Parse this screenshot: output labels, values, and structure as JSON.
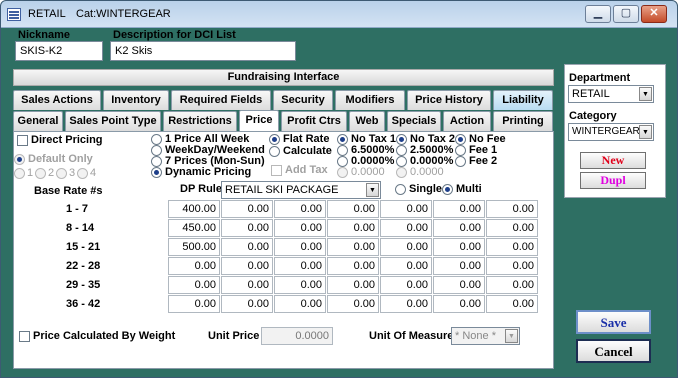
{
  "window": {
    "title": "RETAIL",
    "category_title": "Cat:WINTERGEAR"
  },
  "header": {
    "nickname_label": "Nickname",
    "nickname_value": "SKIS-K2",
    "description_label": "Description for DCI List",
    "description_value": "K2 Skis"
  },
  "fundraising_label": "Fundraising Interface",
  "tabs_row1": [
    "Sales Actions",
    "Inventory",
    "Required Fields",
    "Security",
    "Modifiers",
    "Price History",
    "Liability"
  ],
  "tabs_row2": [
    "General",
    "Sales Point Type",
    "Restrictions",
    "Price",
    "Profit Ctrs",
    "Web",
    "Specials",
    "Action",
    "Printing"
  ],
  "active_tab": "Price",
  "price": {
    "direct_pricing_label": "Direct Pricing",
    "default_only_label": "Default Only",
    "default_options": [
      "1",
      "2",
      "3",
      "4"
    ],
    "price_modes": [
      "1 Price All Week",
      "WeekDay/Weekend",
      "7 Prices (Mon-Sun)",
      "Dynamic Pricing"
    ],
    "price_mode_selected": "Dynamic Pricing",
    "rate_modes": [
      "Flat Rate",
      "Calculate"
    ],
    "rate_mode_selected": "Flat Rate",
    "add_tax_label": "Add Tax",
    "tax1": [
      "No Tax 1",
      "6.5000%",
      "0.0000%",
      "0.0000"
    ],
    "tax2": [
      "No Tax 2",
      "2.5000%",
      "0.0000%",
      "0.0000"
    ],
    "fee": [
      "No Fee",
      "Fee 1",
      "Fee 2"
    ],
    "base_rate_label": "Base Rate #s",
    "dp_rule_label": "DP Rule",
    "dp_rule_value": "RETAIL SKI PACKAGE",
    "single_label": "Single",
    "multi_label": "Multi",
    "multi_selected": true,
    "rows": [
      {
        "range": "1 - 7",
        "values": [
          "400.00",
          "0.00",
          "0.00",
          "0.00",
          "0.00",
          "0.00",
          "0.00"
        ]
      },
      {
        "range": "8 - 14",
        "values": [
          "450.00",
          "0.00",
          "0.00",
          "0.00",
          "0.00",
          "0.00",
          "0.00"
        ]
      },
      {
        "range": "15 - 21",
        "values": [
          "500.00",
          "0.00",
          "0.00",
          "0.00",
          "0.00",
          "0.00",
          "0.00"
        ]
      },
      {
        "range": "22 - 28",
        "values": [
          "0.00",
          "0.00",
          "0.00",
          "0.00",
          "0.00",
          "0.00",
          "0.00"
        ]
      },
      {
        "range": "29 - 35",
        "values": [
          "0.00",
          "0.00",
          "0.00",
          "0.00",
          "0.00",
          "0.00",
          "0.00"
        ]
      },
      {
        "range": "36 - 42",
        "values": [
          "0.00",
          "0.00",
          "0.00",
          "0.00",
          "0.00",
          "0.00",
          "0.00"
        ]
      }
    ],
    "price_by_weight_label": "Price Calculated By Weight",
    "unit_price_label": "Unit Price",
    "unit_price_value": "0.0000",
    "unit_of_measure_label": "Unit Of Measure",
    "unit_of_measure_value": "* None *"
  },
  "side": {
    "department_label": "Department",
    "department_value": "RETAIL",
    "category_label": "Category",
    "category_value": "WINTERGEAR",
    "new_label": "New",
    "dupl_label": "Dupl",
    "new_color": "#e0001a",
    "dupl_color": "#e000e0"
  },
  "actions": {
    "save_label": "Save",
    "cancel_label": "Cancel",
    "save_color": "#1a2fa8"
  }
}
